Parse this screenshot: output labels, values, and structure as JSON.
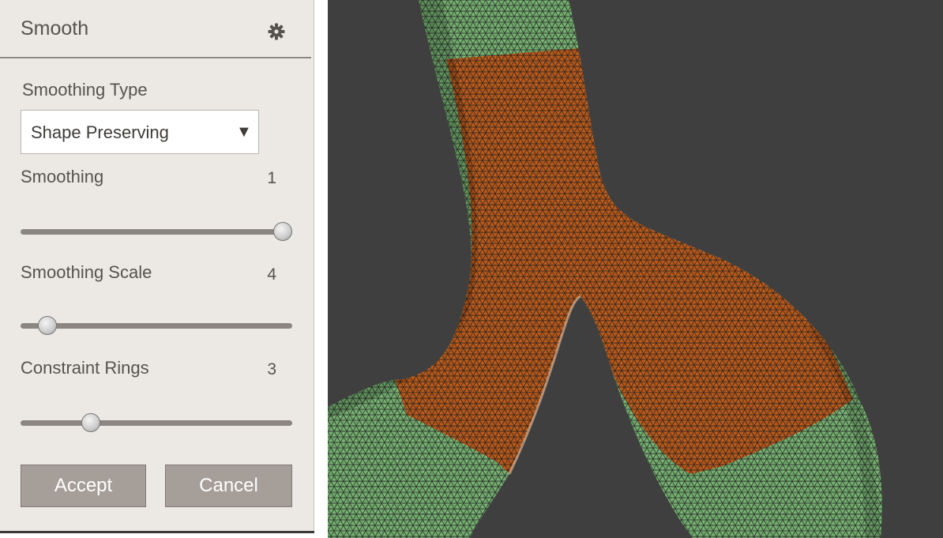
{
  "panel": {
    "title": "Smooth",
    "smoothing_type": {
      "label": "Smoothing Type",
      "selected": "Shape Preserving",
      "arrow": "▼"
    },
    "sliders": [
      {
        "label": "Smoothing",
        "value": "1",
        "fraction": 1.0
      },
      {
        "label": "Smoothing Scale",
        "value": "4",
        "fraction": 0.07
      },
      {
        "label": "Constraint Rings",
        "value": "3",
        "fraction": 0.24
      }
    ],
    "accept_label": "Accept",
    "cancel_label": "Cancel",
    "icons": {
      "settings": "gear-icon"
    }
  },
  "viewport": {
    "background": "#3f3f3f",
    "mesh_selected_color": "#c8601c",
    "mesh_unselected_color": "#7fbf7a",
    "wire_color": "#1c1c1c"
  }
}
